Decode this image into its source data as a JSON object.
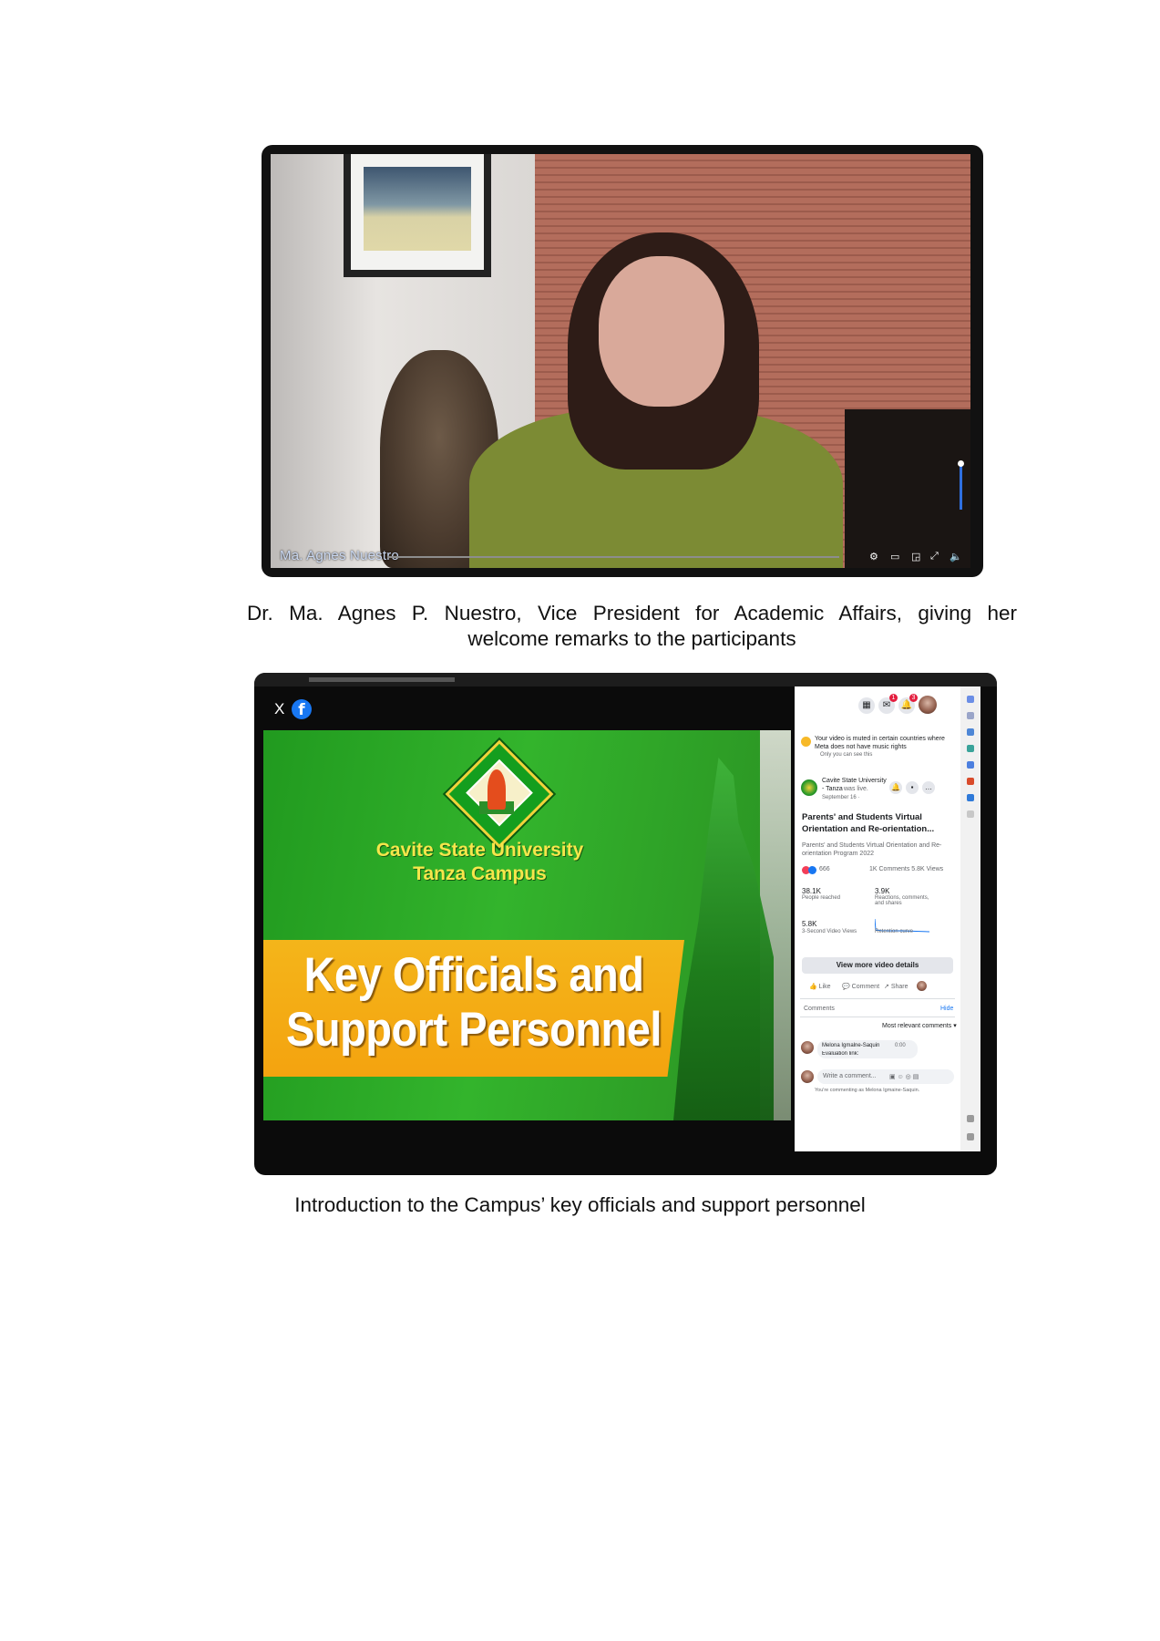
{
  "figure1": {
    "speaker_name_overlay": "Ma. Agnes Nuestro",
    "caption_line1": "Dr. Ma. Agnes P. Nuestro, Vice President for Academic Affairs, giving her",
    "caption_line2": "welcome remarks to the participants"
  },
  "figure2": {
    "close_label": "X",
    "facebook_logo": "f",
    "slide": {
      "university": "Cavite State University",
      "campus": "Tanza Campus",
      "banner_line1": "Key  Officials and",
      "banner_line2": "Support Personnel"
    },
    "fb_panel": {
      "badges": [
        "1",
        "3"
      ],
      "mute_notice_line1": "Your video is muted in certain countries where",
      "mute_notice_line2": "Meta does not have music rights",
      "mute_notice_sub": "Only you can see this",
      "page_name_line1": "Cavite State University",
      "page_name_line2": "- Tanza",
      "page_was_live": "was live.",
      "post_date": "September 16 · ",
      "post_title_line1": "Parents' and Students Virtual",
      "post_title_line2": "Orientation and Re-orientation...",
      "post_desc_line1": "Parents' and Students Virtual Orientation and Re-",
      "post_desc_line2": "orientation Program 2022",
      "reaction_count": "666",
      "comments_views": "1K Comments  5.8K Views",
      "stats": [
        {
          "value": "38.1K",
          "label": "People reached"
        },
        {
          "value": "3.9K",
          "label": "Reactions, comments, and shares"
        },
        {
          "value": "5.8K",
          "label": "3-Second Video Views"
        },
        {
          "value": "",
          "label": "Retention curve"
        }
      ],
      "view_details_button": "View more video details",
      "like_label": "Like",
      "comment_label": "Comment",
      "share_label": "Share",
      "comments_heading": "Comments",
      "hide_label": "Hide",
      "sort_label": "Most relevant comments ▾",
      "commenter_name": "Melona Igmalne-Saquin",
      "comment_time": "0:00",
      "comment_preview": "Evaluation link:",
      "write_placeholder": "Write a comment...",
      "commenting_as": "You're commenting as Melona Igmaine-Saquin."
    },
    "caption": "Introduction to the Campus’ key officials and support personnel"
  },
  "colors": {
    "slide_green": "#2aa425",
    "banner_orange": "#f4a30f",
    "title_yellow": "#f6e64b",
    "facebook_blue": "#1877f2"
  }
}
